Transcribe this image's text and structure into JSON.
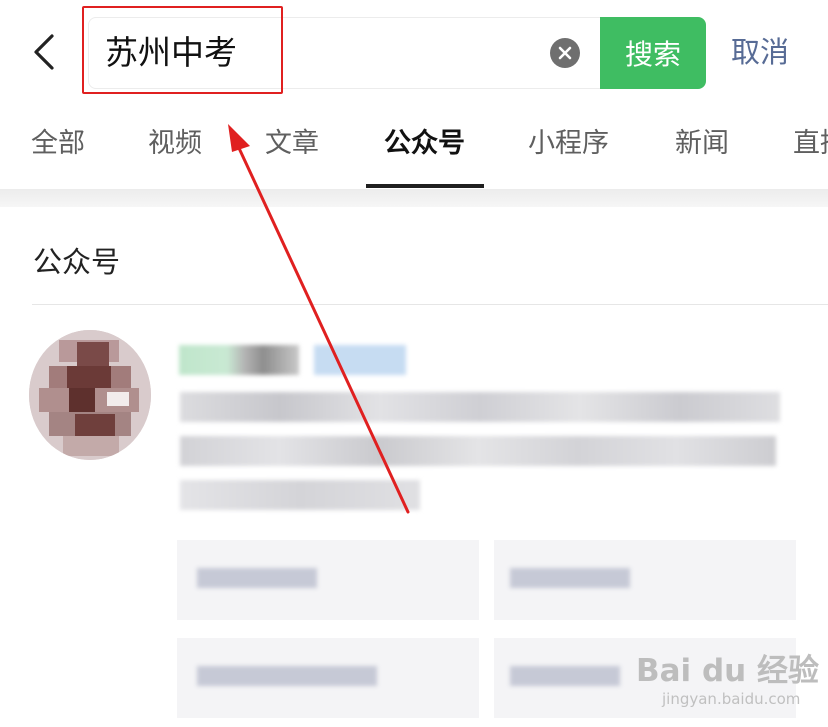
{
  "header": {
    "search_value": "苏州中考",
    "search_button_label": "搜索",
    "cancel_label": "取消"
  },
  "tabs": [
    {
      "label": "全部"
    },
    {
      "label": "视频"
    },
    {
      "label": "文章"
    },
    {
      "label": "公众号"
    },
    {
      "label": "小程序"
    },
    {
      "label": "新闻"
    },
    {
      "label": "直播"
    }
  ],
  "active_tab": "公众号",
  "section": {
    "title": "公众号"
  },
  "colors": {
    "accent_green": "#3fbd62",
    "cancel_link": "#576b95",
    "annotation_red": "#e02020"
  },
  "watermark": {
    "brand": "Bai du 经验",
    "url": "jingyan.baidu.com"
  }
}
